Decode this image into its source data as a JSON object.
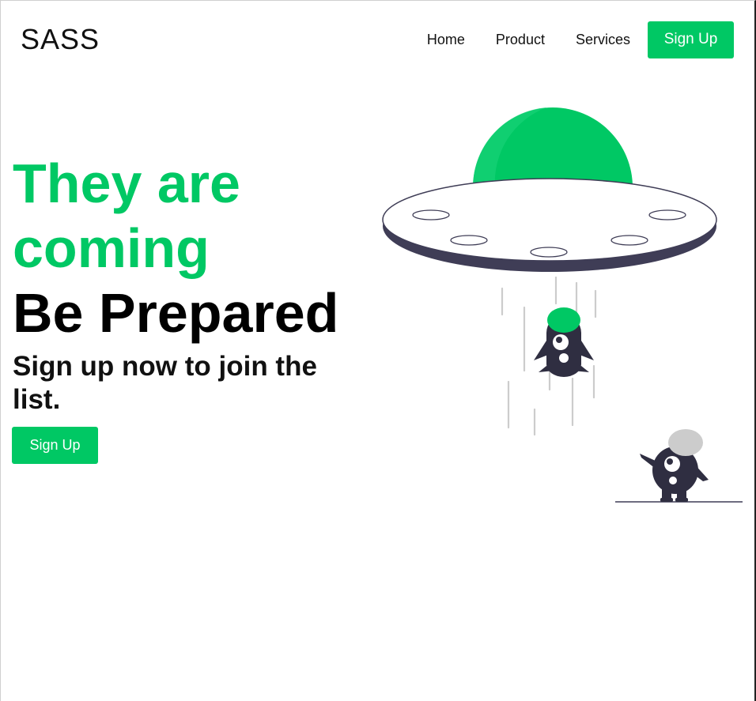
{
  "header": {
    "brand": "SASS",
    "nav": [
      "Home",
      "Product",
      "Services"
    ],
    "signup_label": "Sign Up"
  },
  "hero": {
    "headline_line1": "They are",
    "headline_line2": "coming",
    "headline_line3": "Be Prepared",
    "subtitle": "Sign up now to join the list.",
    "cta_label": "Sign Up"
  },
  "colors": {
    "accent": "#00c864",
    "dark": "#2f2e41",
    "gray": "#cccccc"
  },
  "illustration": {
    "icon": "ufo-abduction-illustration"
  }
}
